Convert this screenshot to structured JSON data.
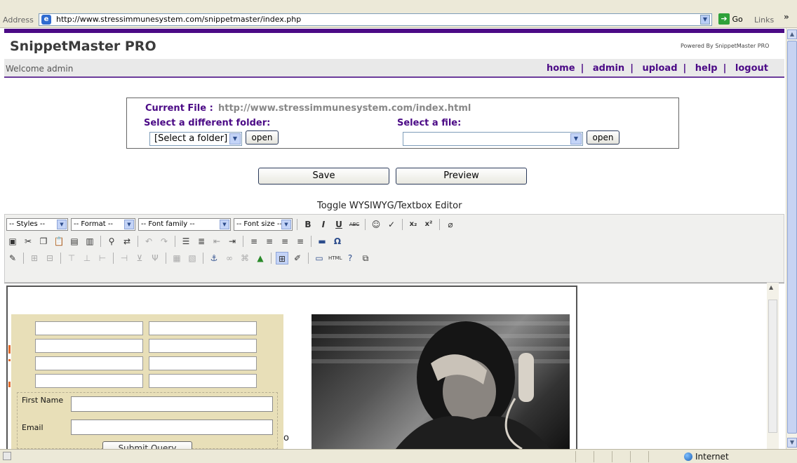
{
  "browser": {
    "address_label": "Address",
    "url": "http://www.stressimmunesystem.com/snippetmaster/index.php",
    "go_label": "Go",
    "links_label": "Links",
    "chevron": "»"
  },
  "app": {
    "title": "SnippetMaster PRO",
    "powered_by": "Powered By SnippetMaster PRO",
    "welcome": "Welcome admin",
    "nav": [
      "home",
      "admin",
      "upload",
      "help",
      "logout"
    ]
  },
  "file_panel": {
    "current_file_label": "Current File :",
    "current_file_value": "http://www.stressimmunesystem.com/index.html",
    "folder_label": "Select a different folder:",
    "folder_selected": "[Select a folder]",
    "folder_open": "open",
    "file_label": "Select a file:",
    "file_selected": "",
    "file_open": "open"
  },
  "actions": {
    "save": "Save",
    "preview": "Preview",
    "toggle": "Toggle WYSIWYG/Textbox Editor"
  },
  "toolbar": {
    "styles": "-- Styles --",
    "format": "-- Format --",
    "font_family": "-- Font family --",
    "font_size": "-- Font size --",
    "bold": "B",
    "italic": "I",
    "underline": "U",
    "strike": "ABC",
    "subscript": "x₂",
    "superscript": "x²",
    "omega": "Ω"
  },
  "editor_form": {
    "first_name_label": "First Name",
    "email_label": "Email",
    "submit": "Submit Query",
    "stray_text": "o"
  },
  "status": {
    "zone": "Internet"
  }
}
